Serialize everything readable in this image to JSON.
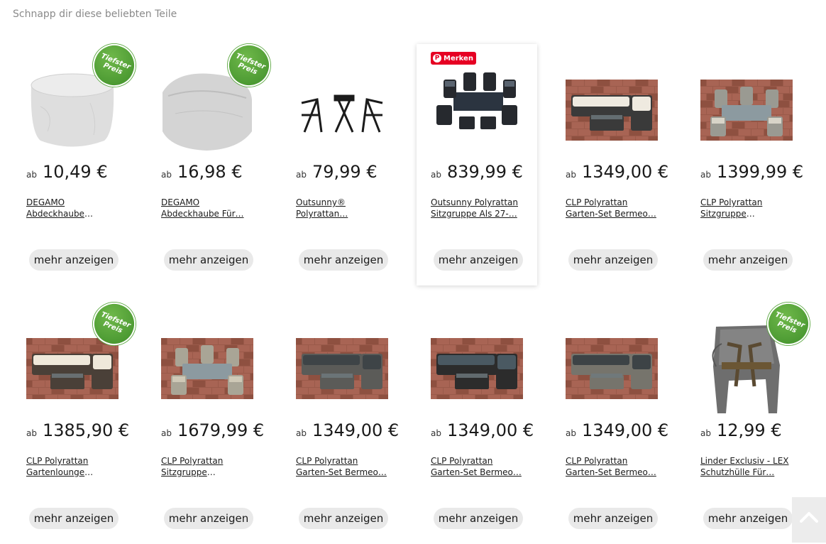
{
  "section": {
    "title": "Schnapp dir diese beliebten Teile"
  },
  "common": {
    "price_prefix": "ab",
    "button_label": "mehr anzeigen",
    "badge_line1": "Tiefster",
    "badge_line2": "Preis",
    "merken_label": "Merken",
    "pin_letter": "P"
  },
  "colors": {
    "badge": "#4ea234",
    "merken": "#e60023",
    "button_bg": "#e9e9e9"
  },
  "products": [
    {
      "name": "DEGAMO Abdeckhaube Tisch…",
      "price": "10,49 €",
      "badge": true,
      "image": "round-cover",
      "merken": false
    },
    {
      "name": "DEGAMO Abdeckhaube Für…",
      "price": "16,98 €",
      "badge": true,
      "image": "lounge-cover",
      "merken": false
    },
    {
      "name": "Outsunny® Polyrattan…",
      "price": "79,99 €",
      "badge": false,
      "image": "bistro-set",
      "merken": false
    },
    {
      "name": "Outsunny Polyrattan Sitzgruppe Als 27-…",
      "price": "839,99 €",
      "badge": false,
      "image": "dining-black",
      "merken": true
    },
    {
      "name": "CLP Polyrattan Garten-Set Bermeo…",
      "price": "1349,00 €",
      "badge": false,
      "image": "corner-dark-cream",
      "merken": false
    },
    {
      "name": "CLP Polyrattan Sitzgruppe Fontana…",
      "price": "1399,99 €",
      "badge": false,
      "image": "dining-grey",
      "merken": false
    },
    {
      "name": "CLP Polyrattan Gartenlounge Santa…",
      "price": "1385,90 €",
      "badge": true,
      "image": "corner-brown-cream",
      "merken": false
    },
    {
      "name": "CLP Polyrattan Sitzgruppe Fontana…",
      "price": "1679,99 €",
      "badge": false,
      "image": "dining-sand",
      "merken": false
    },
    {
      "name": "CLP Polyrattan Garten-Set Bermeo…",
      "price": "1349,00 €",
      "badge": false,
      "image": "corner-grey-dark",
      "merken": false
    },
    {
      "name": "CLP Polyrattan Garten-Set Bermeo…",
      "price": "1349,00 €",
      "badge": false,
      "image": "corner-black-blue",
      "merken": false
    },
    {
      "name": "CLP Polyrattan Garten-Set Bermeo…",
      "price": "1349,00 €",
      "badge": false,
      "image": "corner-grey-dark2",
      "merken": false
    },
    {
      "name": "Linder Exclusiv - LEX Schutzhülle Für…",
      "price": "12,99 €",
      "badge": true,
      "image": "chair-cover",
      "merken": false
    }
  ],
  "scroll_top": {
    "icon": "chevron-up-icon"
  }
}
